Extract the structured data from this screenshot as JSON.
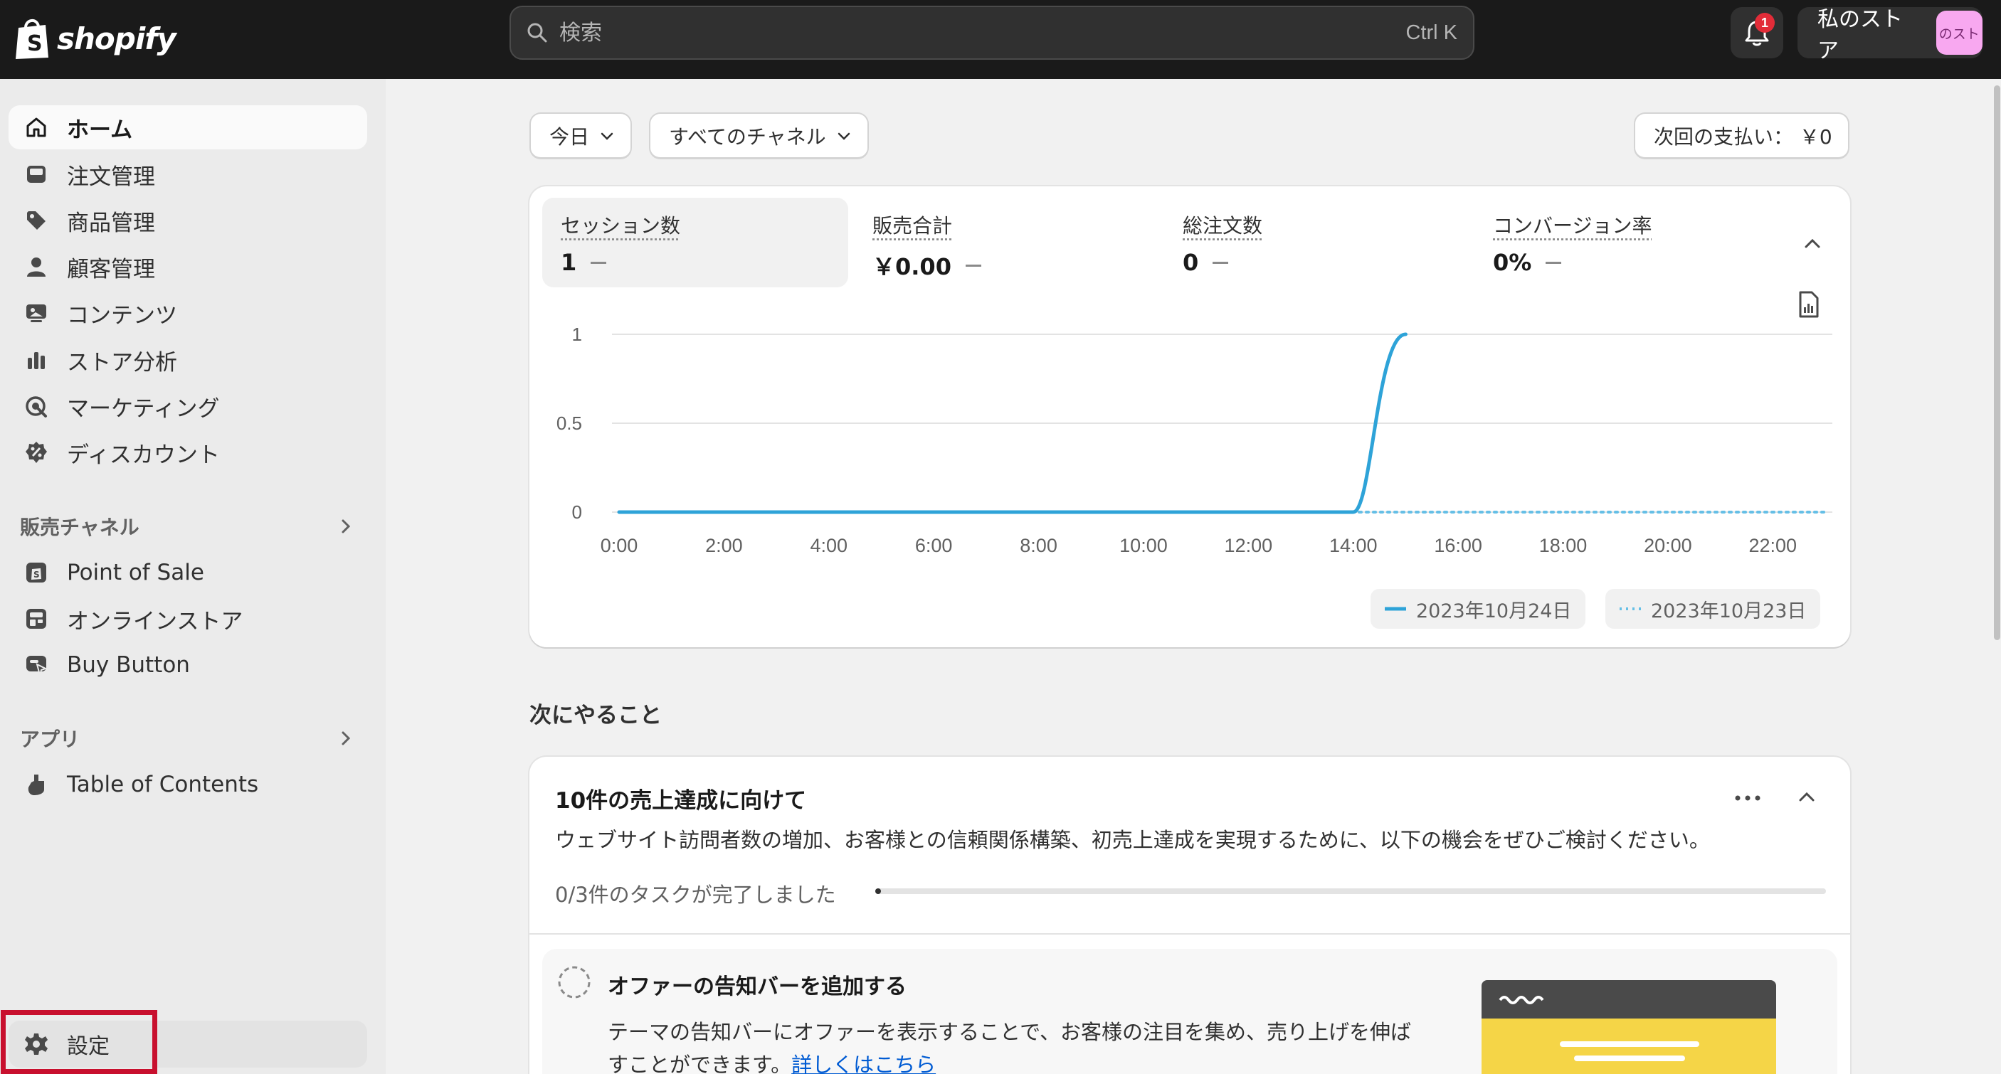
{
  "topbar": {
    "brand": "shopify",
    "search_placeholder": "検索",
    "search_shortcut": "Ctrl K",
    "notification_count": "1",
    "store_name": "私のストア",
    "store_avatar_text": "のスト"
  },
  "sidebar": {
    "items": [
      {
        "label": "ホーム",
        "icon": "home-icon"
      },
      {
        "label": "注文管理",
        "icon": "inbox-icon"
      },
      {
        "label": "商品管理",
        "icon": "tag-icon"
      },
      {
        "label": "顧客管理",
        "icon": "person-icon"
      },
      {
        "label": "コンテンツ",
        "icon": "image-icon"
      },
      {
        "label": "ストア分析",
        "icon": "bar-chart-icon"
      },
      {
        "label": "マーケティング",
        "icon": "target-icon"
      },
      {
        "label": "ディスカウント",
        "icon": "discount-icon"
      }
    ],
    "sales_channels": {
      "heading": "販売チャネル",
      "items": [
        {
          "label": "Point of Sale",
          "icon": "pos-icon"
        },
        {
          "label": "オンラインストア",
          "icon": "store-icon"
        },
        {
          "label": "Buy Button",
          "icon": "buy-button-icon"
        }
      ]
    },
    "apps": {
      "heading": "アプリ",
      "items": [
        {
          "label": "Table of Contents",
          "icon": "app-icon"
        }
      ]
    },
    "settings_label": "設定"
  },
  "filters": {
    "date": "今日",
    "channel": "すべてのチャネル",
    "next_payout": "次回の支払い： ￥0"
  },
  "metrics": [
    {
      "label": "セッション数",
      "value": "1"
    },
    {
      "label": "販売合計",
      "value": "￥0.00"
    },
    {
      "label": "総注文数",
      "value": "0"
    },
    {
      "label": "コンバージョン率",
      "value": "0%"
    }
  ],
  "chart_data": {
    "type": "line",
    "x": [
      "0:00",
      "2:00",
      "4:00",
      "6:00",
      "8:00",
      "10:00",
      "12:00",
      "14:00",
      "16:00",
      "18:00",
      "20:00",
      "22:00"
    ],
    "ylim": [
      0,
      1
    ],
    "yticks": [
      "0",
      "0.5",
      "1"
    ],
    "series": [
      {
        "name": "2023年10月24日",
        "style": "solid",
        "color": "#2ea3d8",
        "points": [
          [
            0,
            0
          ],
          [
            14,
            0
          ],
          [
            15,
            1
          ]
        ]
      },
      {
        "name": "2023年10月23日",
        "style": "dotted",
        "color": "#65bfe6",
        "points": [
          [
            0,
            0
          ],
          [
            23,
            0
          ]
        ]
      }
    ],
    "grid": true,
    "legend": "bottom-right"
  },
  "next_actions": {
    "heading": "次にやること",
    "task_title": "10件の売上達成に向けて",
    "task_desc": "ウェブサイト訪問者数の増加、お客様との信頼関係構築、初売上達成を実現するために、以下の機会をぜひご検討ください。",
    "progress_text": "0/3件のタスクが完了しました",
    "progress_fraction": 0.005,
    "offer_title": "オファーの告知バーを追加する",
    "offer_desc": "テーマの告知バーにオファーを表示することで、お客様の注目を集め、売り上げを伸ばすことができます。",
    "offer_link": "詳しくはこちら"
  },
  "colors": {
    "topbar": "#1a1a1a",
    "chart_line": "#2ea3d8",
    "highlight": "#c8102e",
    "link": "#005bd3"
  }
}
